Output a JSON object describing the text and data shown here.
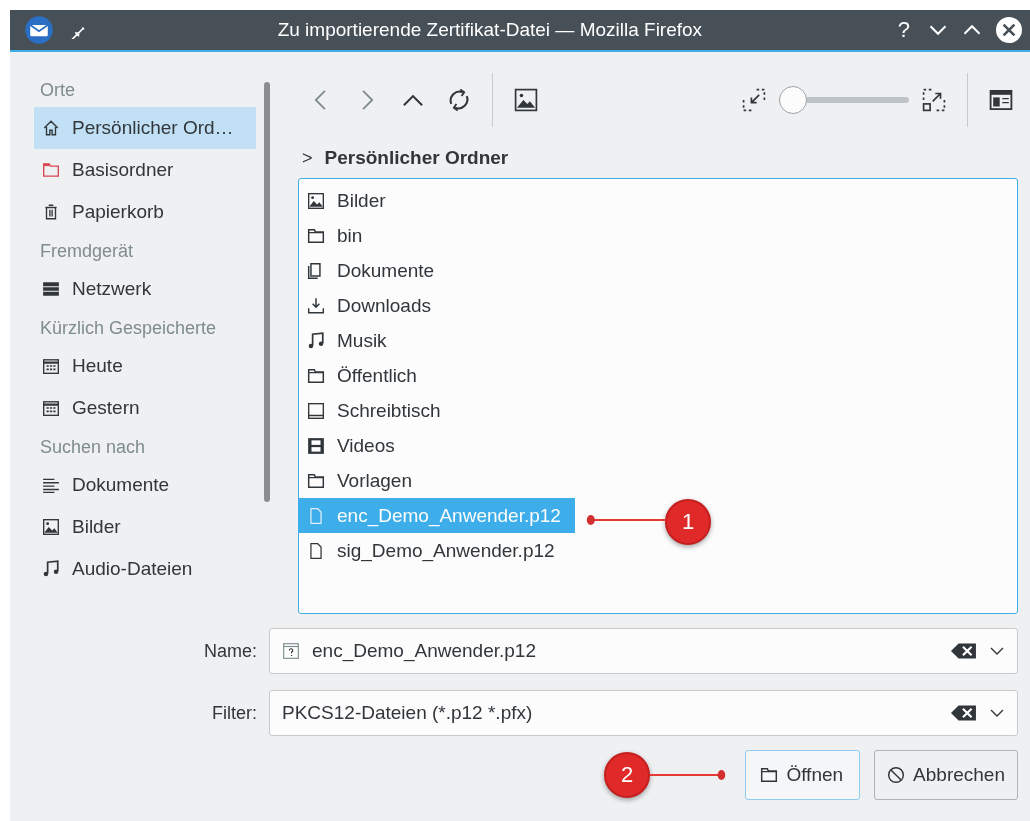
{
  "window": {
    "title": "Zu importierende Zertifikat-Datei — Mozilla Firefox",
    "buttons": [
      {
        "kind": "help",
        "label": "?"
      },
      {
        "kind": "minimize"
      },
      {
        "kind": "maximize"
      },
      {
        "kind": "close"
      }
    ]
  },
  "sidebar": {
    "sections": [
      {
        "title": "Orte",
        "items": [
          {
            "label": "Persönlicher Ord…",
            "selected": true
          },
          {
            "label": "Basisordner",
            "selected": false
          },
          {
            "label": "Papierkorb",
            "selected": false
          }
        ]
      },
      {
        "title": "Fremdgerät",
        "items": [
          {
            "label": "Netzwerk",
            "selected": false
          }
        ]
      },
      {
        "title": "Kürzlich Gespeicherte",
        "items": [
          {
            "label": "Heute",
            "selected": false
          },
          {
            "label": "Gestern",
            "selected": false
          }
        ]
      },
      {
        "title": "Suchen nach",
        "items": [
          {
            "label": "Dokumente",
            "selected": false
          },
          {
            "label": "Bilder",
            "selected": false
          },
          {
            "label": "Audio-Dateien",
            "selected": false
          }
        ]
      }
    ]
  },
  "toolbar": {
    "zoom_slider": {
      "level": 0
    }
  },
  "breadcrumb": {
    "separator": ">",
    "location": "Persönlicher Ordner"
  },
  "files": [
    {
      "name": "Bilder",
      "kind": "pictures",
      "selected": false
    },
    {
      "name": "bin",
      "kind": "folder",
      "selected": false
    },
    {
      "name": "Dokumente",
      "kind": "documents",
      "selected": false
    },
    {
      "name": "Downloads",
      "kind": "downloads",
      "selected": false
    },
    {
      "name": "Musik",
      "kind": "music",
      "selected": false
    },
    {
      "name": "Öffentlich",
      "kind": "folder",
      "selected": false
    },
    {
      "name": "Schreibtisch",
      "kind": "desktop",
      "selected": false
    },
    {
      "name": "Videos",
      "kind": "videos",
      "selected": false
    },
    {
      "name": "Vorlagen",
      "kind": "folder",
      "selected": false
    },
    {
      "name": "enc_Demo_Anwender.p12",
      "kind": "file",
      "selected": true
    },
    {
      "name": "sig_Demo_Anwender.p12",
      "kind": "file",
      "selected": false
    }
  ],
  "name_field": {
    "label": "Name:",
    "value": "enc_Demo_Anwender.p12"
  },
  "filter_field": {
    "label": "Filter:",
    "value": "PKCS12-Dateien (*.p12 *.pfx)"
  },
  "buttons": [
    {
      "label": "Öffnen",
      "kind": "open"
    },
    {
      "label": "Abbrechen",
      "kind": "cancel"
    }
  ],
  "annotations": [
    {
      "label": "1"
    },
    {
      "label": "2"
    }
  ]
}
